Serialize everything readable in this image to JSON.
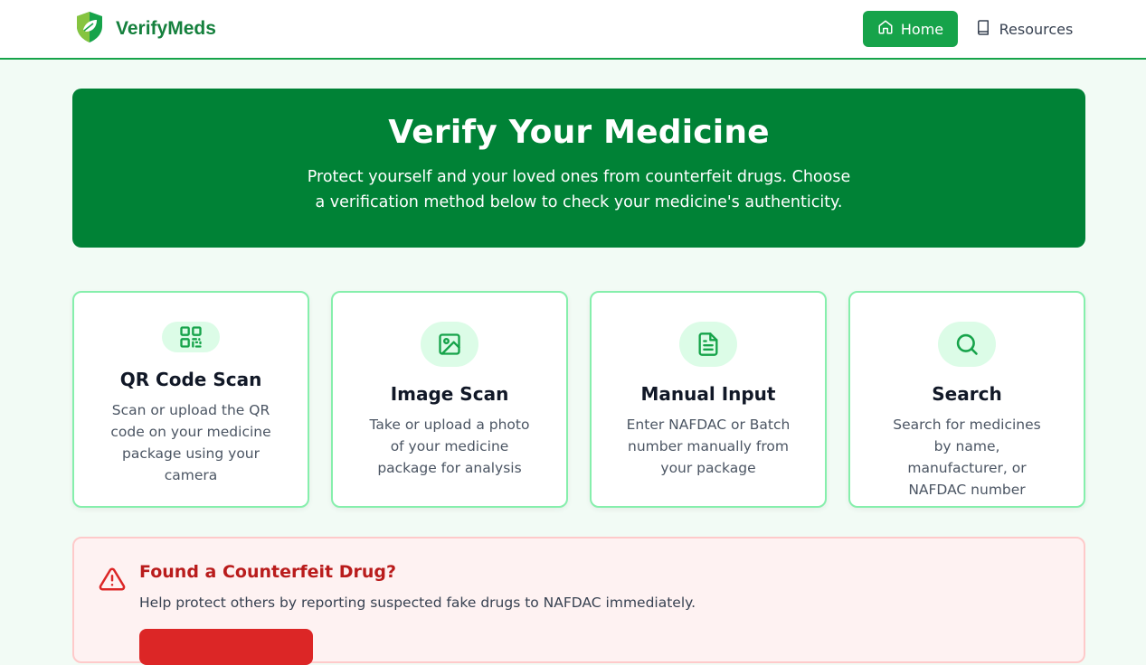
{
  "brand": {
    "name": "VerifyMeds",
    "logo_icon": "shield-leaf-icon"
  },
  "nav": {
    "home_label": "Home",
    "home_icon": "home-icon",
    "resources_label": "Resources",
    "resources_icon": "book-icon"
  },
  "hero": {
    "title": "Verify Your Medicine",
    "subtitle": "Protect yourself and your loved ones from counterfeit drugs. Choose a verification method below to check your medicine's authenticity."
  },
  "methods": [
    {
      "title": "QR Code Scan",
      "description": "Scan or upload the QR code on your medicine package using your camera",
      "icon": "qr-code-icon"
    },
    {
      "title": "Image Scan",
      "description": "Take or upload a photo of your medicine package for analysis",
      "icon": "image-icon"
    },
    {
      "title": "Manual Input",
      "description": "Enter NAFDAC or Batch number manually from your package",
      "icon": "document-icon"
    },
    {
      "title": "Search",
      "description": "Search for medicines by name, manufacturer, or NAFDAC number",
      "icon": "search-icon"
    }
  ],
  "alert": {
    "title": "Found a Counterfeit Drug?",
    "text": "Help protect others by reporting suspected fake drugs to NAFDAC immediately.",
    "icon": "warning-triangle-icon"
  },
  "colors": {
    "primary": "#16a34a",
    "hero_bg": "#008236",
    "card_border": "#86efac",
    "icon_bubble": "#dcfce7",
    "alert_bg": "#fef2f2",
    "alert_title": "#b91c1c"
  }
}
